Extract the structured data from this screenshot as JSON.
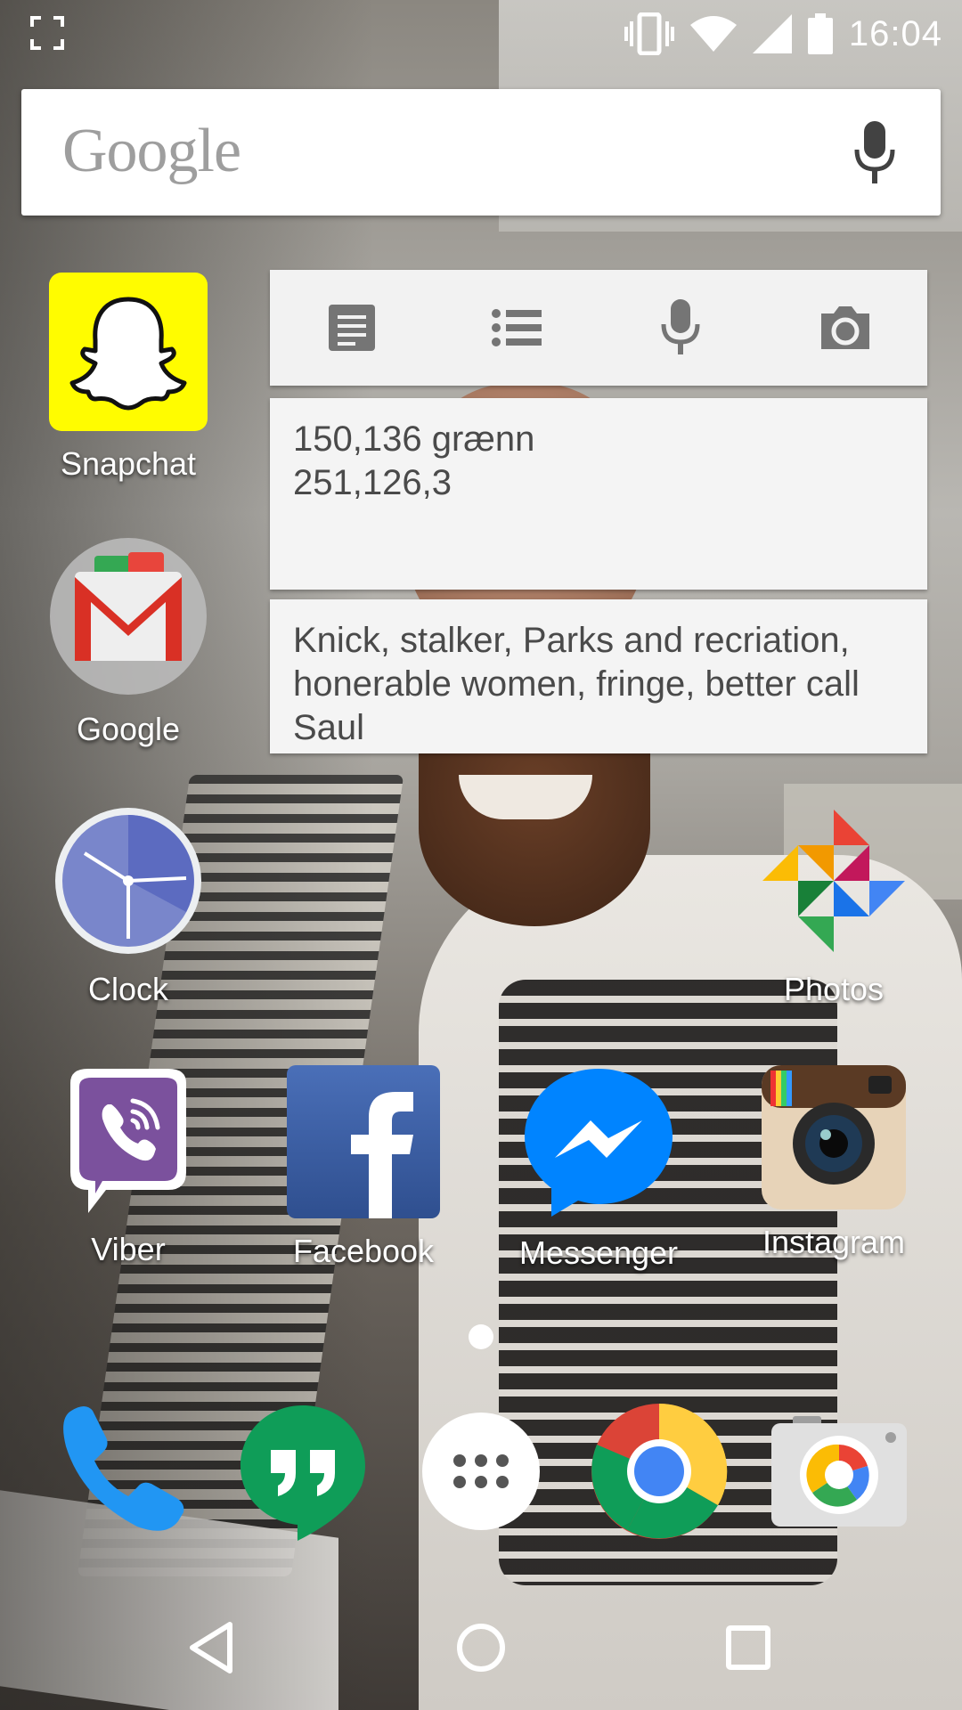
{
  "status_bar": {
    "time": "16:04",
    "icons": [
      "screenshot-icon",
      "vibrate-icon",
      "wifi-icon",
      "signal-icon",
      "battery-icon"
    ]
  },
  "search_bar": {
    "logo_text": "Google",
    "mic_icon": "microphone-icon"
  },
  "apps": {
    "snapchat": {
      "label": "Snapchat",
      "color": "#FFFC00"
    },
    "google_folder": {
      "label": "Google"
    },
    "clock": {
      "label": "Clock"
    },
    "photos": {
      "label": "Photos"
    },
    "viber": {
      "label": "Viber",
      "color": "#7B519D"
    },
    "facebook": {
      "label": "Facebook",
      "color": "#3B5998"
    },
    "messenger": {
      "label": "Messenger",
      "color": "#0084FF"
    },
    "instagram": {
      "label": "Instagram"
    }
  },
  "keep_widget": {
    "toolbar": [
      "new-note-icon",
      "list-icon",
      "microphone-icon",
      "camera-icon"
    ],
    "notes": [
      {
        "lines": [
          "150,136 grænn",
          "251,126,3"
        ]
      },
      {
        "lines": [
          "Knick, stalker, Parks and recriation,",
          "honerable women, fringe, better call",
          "Saul"
        ]
      }
    ]
  },
  "dock": [
    "phone-icon",
    "hangouts-icon",
    "app-drawer-icon",
    "chrome-icon",
    "camera-app-icon"
  ],
  "navbar": [
    "back-icon",
    "home-icon",
    "recents-icon"
  ]
}
